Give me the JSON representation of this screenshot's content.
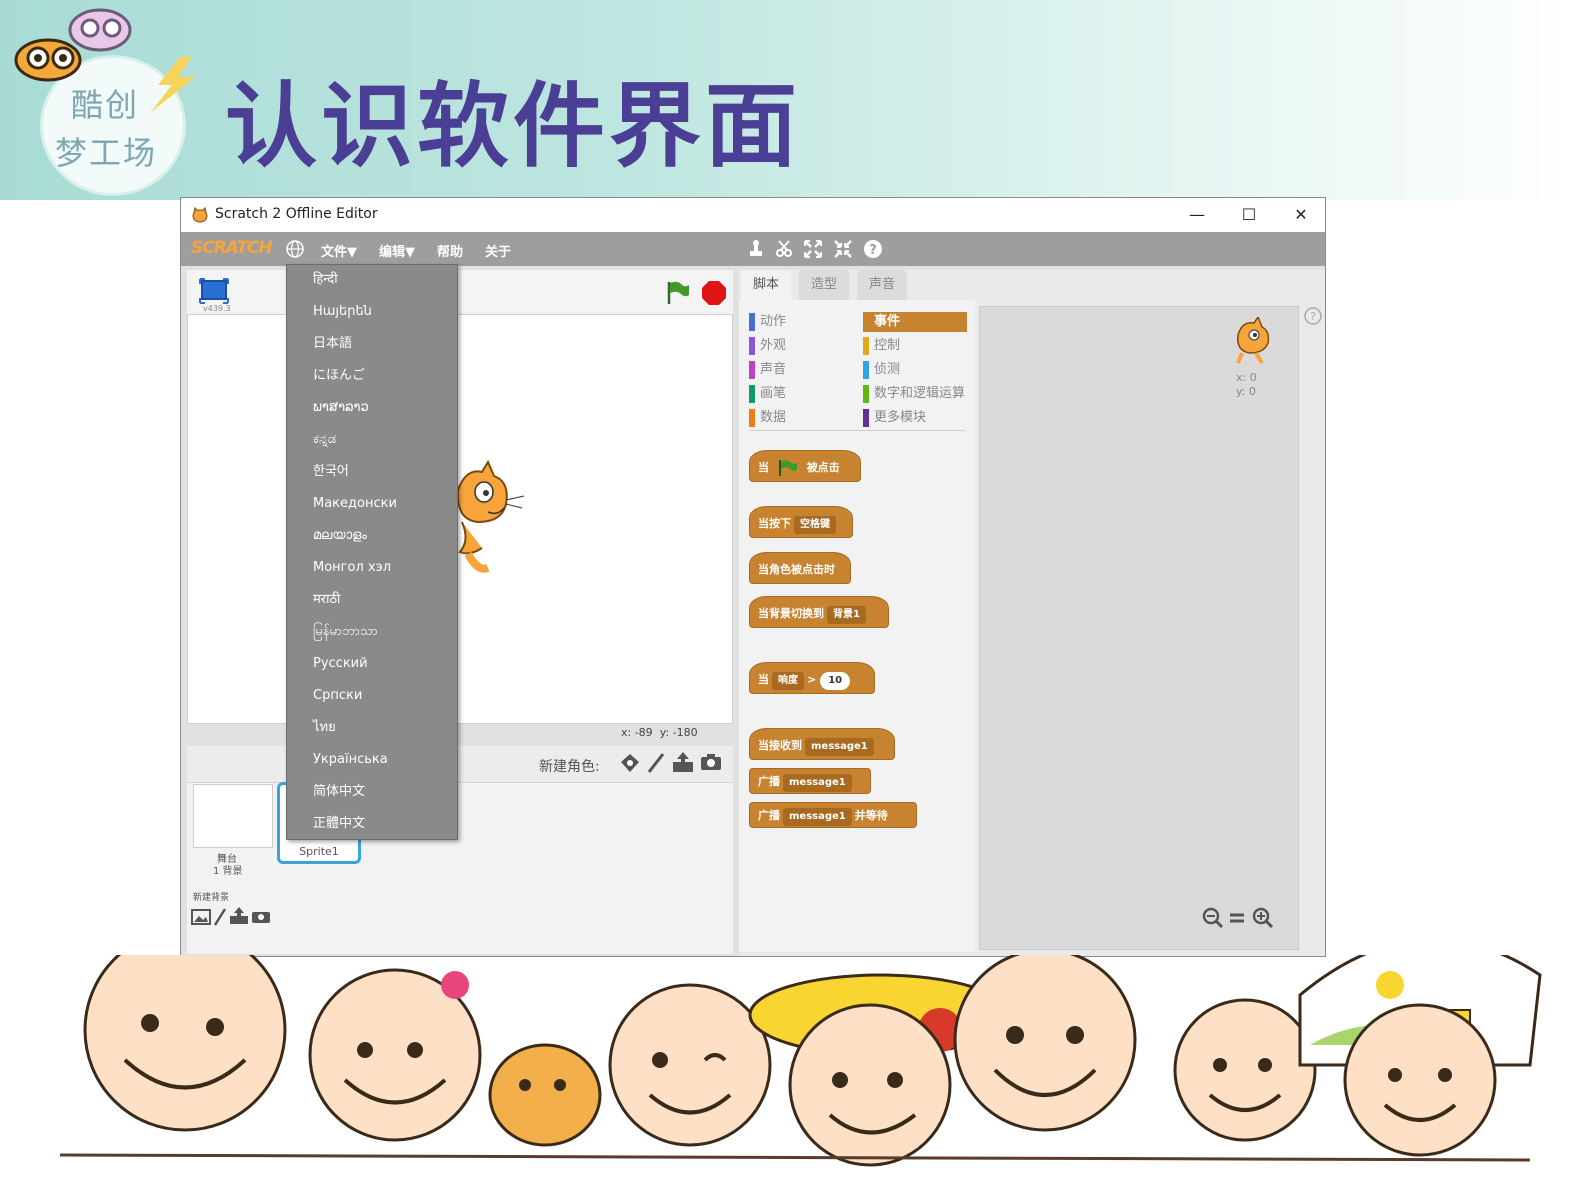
{
  "header": {
    "logo_line1": "酷创",
    "logo_line2": "梦工场",
    "page_title": "认识软件界面"
  },
  "window": {
    "title": "Scratch 2 Offline Editor",
    "minimize": "—",
    "maximize": "☐",
    "close": "✕"
  },
  "menubar": {
    "logo": "SCRATCH",
    "file": "文件▼",
    "edit": "编辑▼",
    "help": "帮助",
    "about": "关于"
  },
  "stage": {
    "version": "v439.3",
    "coord_x": "x: -89",
    "coord_y": "y: -180"
  },
  "sprite_pane": {
    "new_sprite_label": "新建角色:",
    "stage_label": "舞台",
    "stage_backdrops": "1 背景",
    "new_backdrop_label": "新建背景",
    "sprite_name": "Sprite1"
  },
  "language_menu": {
    "items": [
      "हिन्दी",
      "Hայերեն",
      "日本語",
      "にほんご",
      "ພາສາລາວ",
      "ಕನ್ನಡ",
      "한국어",
      "Македонски",
      "മലയാളം",
      "Монгол хэл",
      "मराठी",
      "မြန်မာဘာသာ",
      "Русский",
      "Српски",
      "ไทย",
      "Українська",
      "简体中文",
      "正體中文"
    ]
  },
  "tabs": {
    "scripts": "脚本",
    "costumes": "造型",
    "sounds": "声音"
  },
  "categories": {
    "left": [
      {
        "label": "动作",
        "color": "#4a6cd4"
      },
      {
        "label": "外观",
        "color": "#8a55d7"
      },
      {
        "label": "声音",
        "color": "#bb42c3"
      },
      {
        "label": "画笔",
        "color": "#0e9a6c"
      },
      {
        "label": "数据",
        "color": "#ee7d16"
      }
    ],
    "right": [
      {
        "label": "事件",
        "color": "#c88330"
      },
      {
        "label": "控制",
        "color": "#e1a91a"
      },
      {
        "label": "侦测",
        "color": "#2ca5e2"
      },
      {
        "label": "数字和逻辑运算",
        "color": "#5cb712"
      },
      {
        "label": "更多模块",
        "color": "#632d99"
      }
    ]
  },
  "blocks": {
    "b1_a": "当",
    "b1_b": "被点击",
    "b2_a": "当按下",
    "b2_key": "空格键",
    "b3": "当角色被点击时",
    "b4_a": "当背景切换到",
    "b4_opt": "背景1",
    "b5_a": "当",
    "b5_opt": "响度",
    "b5_op": ">",
    "b5_num": "10",
    "b6_a": "当接收到",
    "b6_opt": "message1",
    "b7_a": "广播",
    "b7_opt": "message1",
    "b8_a": "广播",
    "b8_opt": "message1",
    "b8_b": "并等待"
  },
  "sprite_info": {
    "x": "x: 0",
    "y": "y: 0"
  },
  "colors": {
    "accent": "#c88330",
    "title": "#4b3f95",
    "header_bg": "#a9dbd5",
    "menubar": "#9e9e9e"
  }
}
